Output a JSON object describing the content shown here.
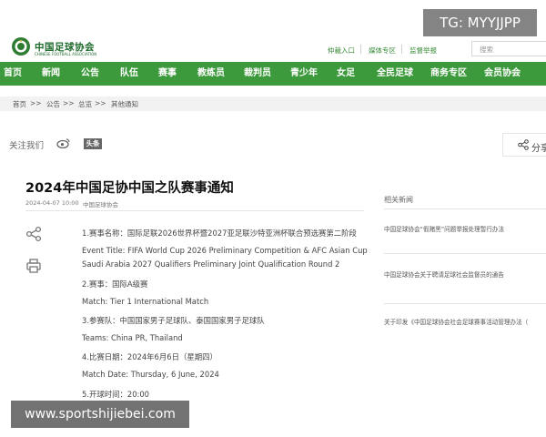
{
  "site": {
    "logo_name": "中国足球协会",
    "logo_subtitle": "CHINESE FOOTBALL ASSOCIATION",
    "brand_color": "#3d9a3c"
  },
  "utility_links": [
    "仲裁入口",
    "媒体专区",
    "监督举报"
  ],
  "search": {
    "placeholder": "搜索"
  },
  "nav": [
    "首页",
    "新闻",
    "公告",
    "队伍",
    "赛事",
    "教练员",
    "裁判员",
    "青少年",
    "女足",
    "全民足球",
    "商务专区",
    "会员协会"
  ],
  "breadcrumb": [
    "首页",
    ">>",
    "公告",
    ">>",
    "总览",
    ">>",
    "其他通知"
  ],
  "share": {
    "label": "关注我们",
    "weibo_icon": "weibo-icon",
    "toutiao_label": "头条",
    "right_label": "分享"
  },
  "article": {
    "title": "2024年中国足协中国之队赛事通知",
    "date": "2024-04-07 10:00",
    "source": "中国足球协会",
    "lines": [
      "1.赛事名称：国际足联2026世界杯暨2027亚足联沙特亚洲杯联合预选赛第二阶段",
      "Event Title: FIFA World Cup 2026 Preliminary Competition & AFC Asian Cup",
      "Saudi Arabia 2027 Qualifiers Preliminary Joint Qualification Round 2",
      "2.赛事：国际A级赛",
      "Match: Tier 1 International Match",
      "3.参赛队：中国国家男子足球队、泰国国家男子足球队",
      "Teams: China PR, Thailand",
      "4.比赛日期：2024年6月6日（星期四）",
      "Match Date: Thursday, 6 June, 2024",
      "5.开球时间：20:00"
    ]
  },
  "related": {
    "title": "相关新闻",
    "items": [
      "中国足球协会“假赌黑”问题举报处理暂行办法",
      "中国足球协会关于聘请足球社会监督员的通告",
      "关于印发《中国足球协会社会足球赛事活动管理办法（"
    ]
  },
  "watermarks": {
    "top_right": "TG: MYYJJPP",
    "bottom_left": "www.sportshijiebei.com"
  }
}
